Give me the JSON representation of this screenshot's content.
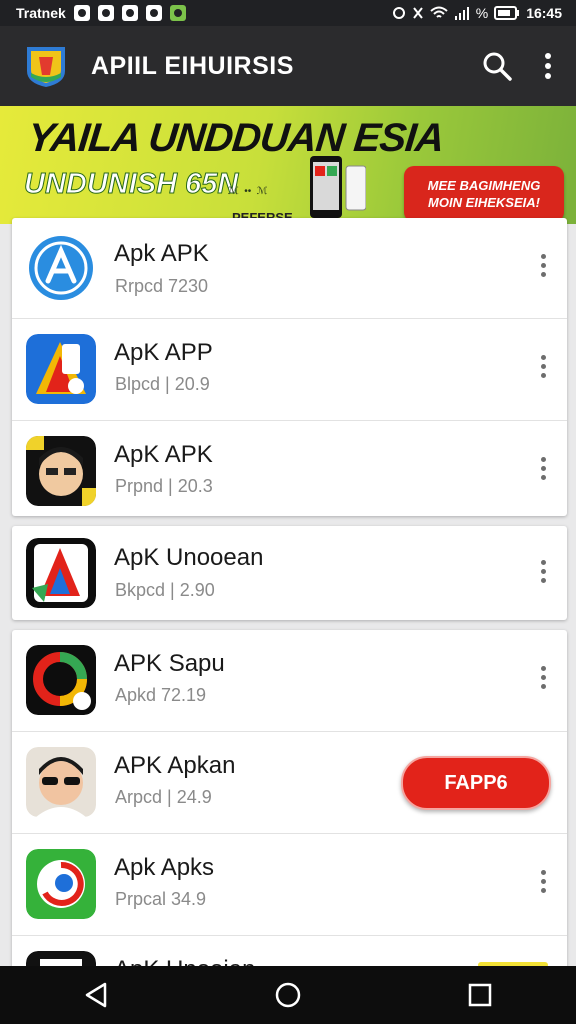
{
  "status": {
    "carrier": "Tratnek",
    "battery": "%",
    "time": "16:45"
  },
  "appbar": {
    "title": "APIIL EIHUIRSIS"
  },
  "banner": {
    "headline": "YAILA UNDDUAN ESIA",
    "subheadline": "UNDUNISH 65N",
    "small_text": "ℳ  ••  ℳ",
    "strip_text": "PEFERSE",
    "cta_line1": "MEE BAGIMHENG",
    "cta_line2": "MOIN EIHEKSEIA!"
  },
  "apps": [
    {
      "name": "Apk APK",
      "meta": "Rrpcd 7230"
    },
    {
      "name": "ApK APP",
      "meta": "Blpcd | 20.9"
    },
    {
      "name": "ApK APK",
      "meta": "Prpnd | 20.3"
    },
    {
      "name": "ApK Unooean",
      "meta": "Bkpcd | 2.90"
    },
    {
      "name": "APK Sapu",
      "meta": "Apkd 72.19"
    },
    {
      "name": "APK Apkan",
      "meta": "Arpcd | 24.9",
      "action": "FAPP6"
    },
    {
      "name": "Apk Apks",
      "meta": "Prpcal 34.9"
    },
    {
      "name": "ApK Unooian",
      "meta": ""
    }
  ],
  "colors": {
    "appbar": "#2b2b2d",
    "accent_red": "#e2231a",
    "banner_green": "#9bc93a"
  },
  "icons": [
    "search-icon",
    "more-vert-icon",
    "back-icon",
    "home-icon",
    "recents-icon"
  ]
}
